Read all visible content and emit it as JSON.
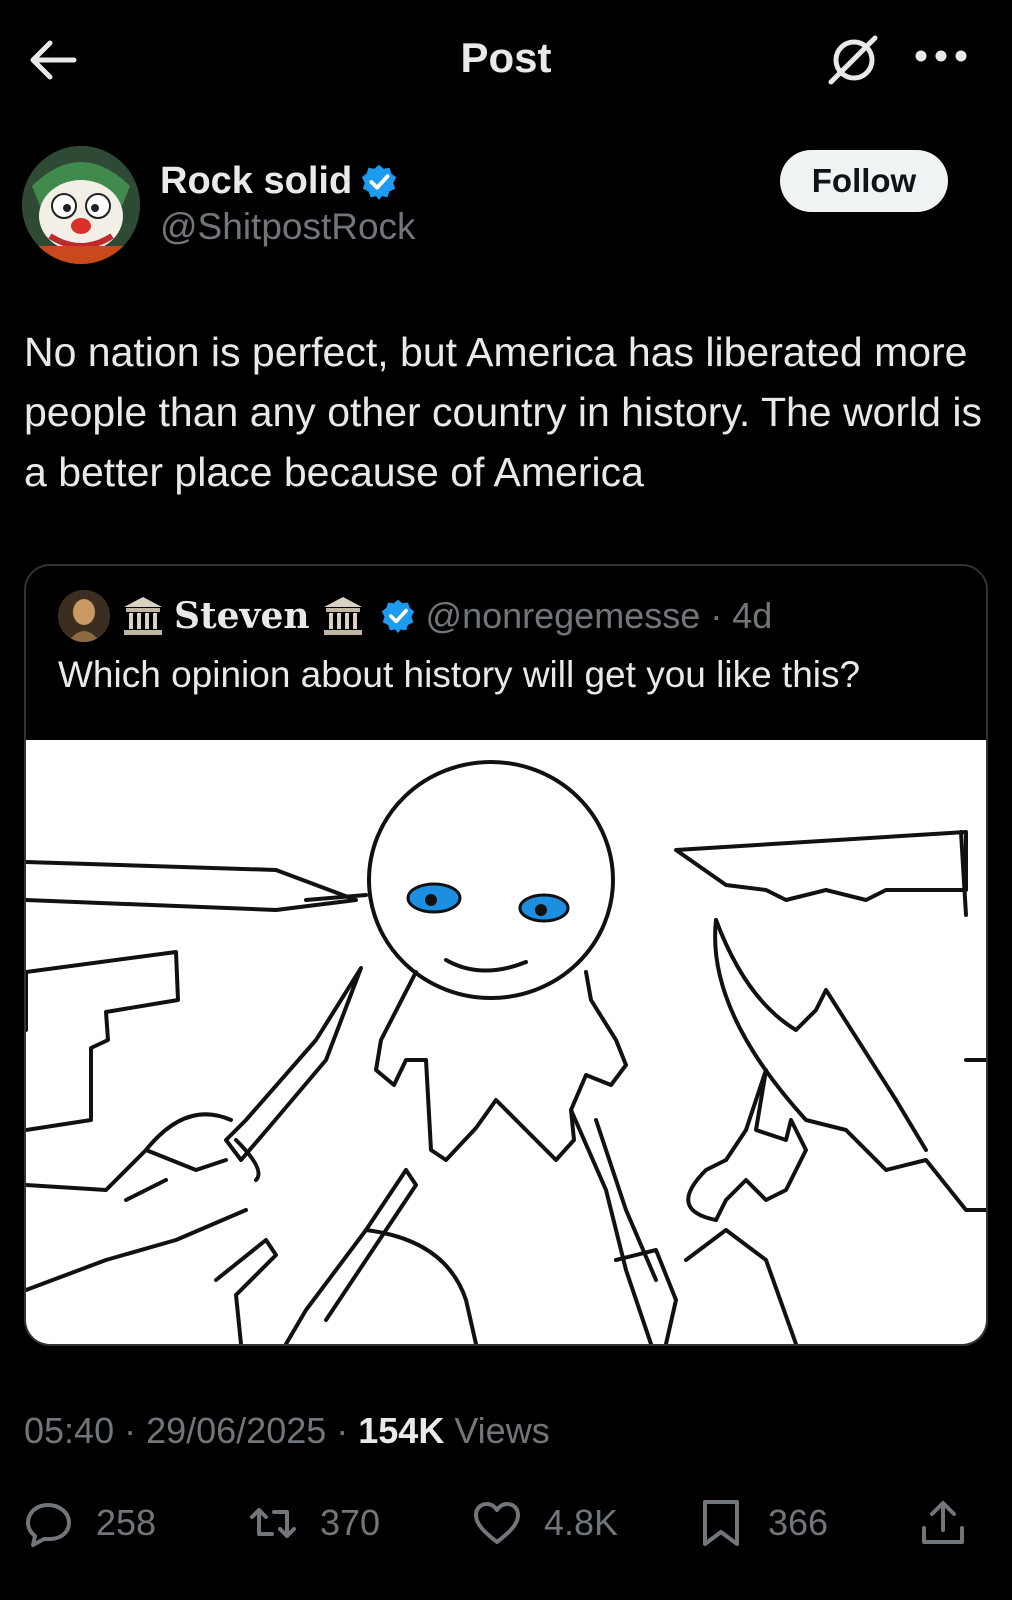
{
  "header": {
    "title": "Post",
    "back_icon": "arrow-left-icon",
    "grok_icon": "grok-icon",
    "more_icon": "more-dots-icon"
  },
  "author": {
    "name": "Rock solid",
    "handle": "@ShitpostRock",
    "follow_label": "Follow",
    "verified": true
  },
  "tweet": {
    "text": "No nation is perfect, but America has liberated more people than any other country in history. The world is a better place because of America"
  },
  "quote": {
    "name": "Steven",
    "handle_time": "@nonregemesse · 4d",
    "text": "Which opinion about history will get you like this?",
    "image_icon": "stabbed-stick-figure-drawing"
  },
  "meta": {
    "time_date": "05:40 · 29/06/2025 · ",
    "views_count": "154K",
    "views_label": " Views"
  },
  "actions": {
    "replies": "258",
    "reposts": "370",
    "likes": "4.8K",
    "bookmarks": "366"
  },
  "colors": {
    "background": "#000000",
    "text": "#e7e9ea",
    "secondary": "#71767b",
    "verified": "#1d9bf0"
  }
}
